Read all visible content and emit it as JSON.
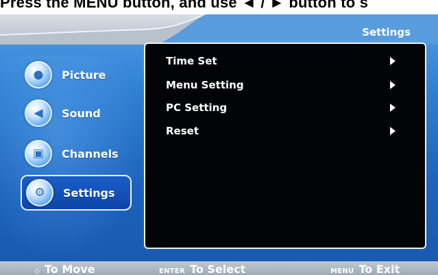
{
  "caption": "Press the MENU button, and use ◄ / ► button to s",
  "screen_title": "Settings",
  "sidebar": {
    "items": [
      {
        "label": "Picture",
        "icon": "person-icon",
        "active": false
      },
      {
        "label": "Sound",
        "icon": "speaker-icon",
        "active": false
      },
      {
        "label": "Channels",
        "icon": "tv-icon",
        "active": false
      },
      {
        "label": "Settings",
        "icon": "gear-icon",
        "active": true
      }
    ]
  },
  "panel": {
    "items": [
      {
        "label": "Time Set",
        "icon": "arrow-right-icon"
      },
      {
        "label": "Menu Setting",
        "icon": "arrow-right-icon"
      },
      {
        "label": "PC Setting",
        "icon": "arrow-right-icon"
      },
      {
        "label": "Reset",
        "icon": "arrow-right-icon"
      }
    ]
  },
  "bottom_bar": {
    "move": {
      "key": "◇",
      "label": "To Move"
    },
    "select": {
      "key": "ENTER",
      "label": "To Select"
    },
    "exit": {
      "key": "MENU",
      "label": "To Exit"
    }
  }
}
